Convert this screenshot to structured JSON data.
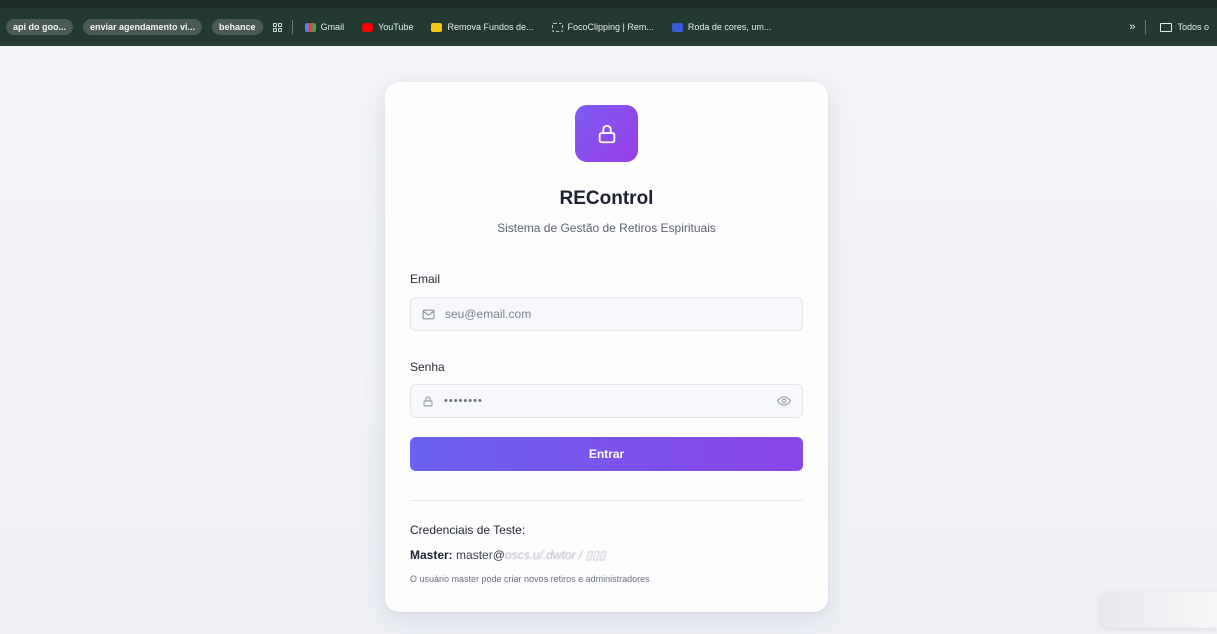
{
  "bookmarks": {
    "items": [
      {
        "label": "api do goo...",
        "style": "pill"
      },
      {
        "label": "enviar agendamento vi...",
        "style": "pill"
      },
      {
        "label": "behance",
        "style": "pill"
      },
      {
        "label": "Gmail",
        "icon": "gmail-icon",
        "color": "#e94235"
      },
      {
        "label": "YouTube",
        "icon": "youtube-icon",
        "color": "#ff0000"
      },
      {
        "label": "Remova Fundos de...",
        "icon": "removebg-icon",
        "color": "#f5c518"
      },
      {
        "label": "FocoClipping | Rem...",
        "icon": "fococlipping-icon",
        "color": "#b9c3bf"
      },
      {
        "label": "Roda de cores, um...",
        "icon": "color-wheel-icon",
        "color": "#3b5ad8"
      }
    ],
    "overflow_label": "»",
    "all_bookmarks_label": "Todos o"
  },
  "login": {
    "app_name": "REControl",
    "subtitle": "Sistema de Gestão de Retiros Espirituais",
    "email_label": "Email",
    "email_placeholder": "seu@email.com",
    "password_label": "Senha",
    "password_value": "••••••••",
    "submit_label": "Entrar",
    "credentials_title": "Credenciais de Teste:",
    "master_label": "Master:",
    "master_value": "master@",
    "master_value_obscured": "oscs.u/.dwtor / ▯▯▯",
    "master_note": "O usuário master pode criar novos retiros e administradores"
  },
  "colors": {
    "accent_start": "#6a62f0",
    "accent_end": "#8a45e6",
    "bookmarks_bar": "#233a33"
  }
}
